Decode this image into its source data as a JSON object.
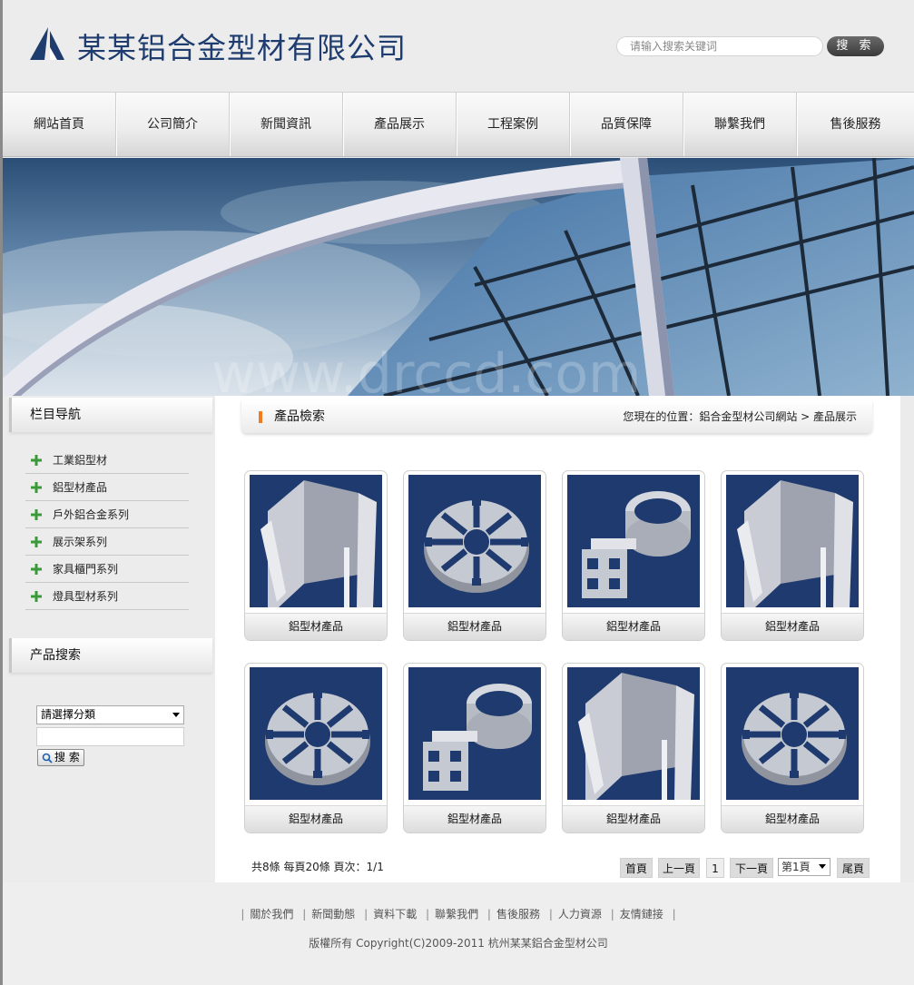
{
  "header": {
    "company_name": "某某铝合金型材有限公司",
    "search_placeholder": "请输入搜索关键词",
    "search_button": "搜 索"
  },
  "nav": {
    "items": [
      "網站首頁",
      "公司簡介",
      "新聞資訊",
      "產品展示",
      "工程案例",
      "品質保障",
      "聯繫我們",
      "售後服務"
    ]
  },
  "banner": {
    "watermark": "www.drccd.com"
  },
  "sidebar": {
    "nav_title": "栏目导航",
    "nav_items": [
      "工業鋁型材",
      "鋁型材產品",
      "戶外鋁合金系列",
      "展示架系列",
      "家具櫃門系列",
      "燈具型材系列"
    ],
    "search_title": "产品搜索",
    "category_select": "請選擇分類",
    "search_button": "搜 索"
  },
  "main": {
    "section_title": "產品檢索",
    "breadcrumb": "您現在的位置：鋁合金型材公司網站 > 產品展示",
    "products": [
      {
        "name": "鋁型材產品",
        "shape": "channel-icon"
      },
      {
        "name": "鋁型材產品",
        "shape": "round-profile-icon"
      },
      {
        "name": "鋁型材產品",
        "shape": "tube-profile-icon"
      },
      {
        "name": "鋁型材產品",
        "shape": "channel-icon"
      },
      {
        "name": "鋁型材產品",
        "shape": "round-profile-icon"
      },
      {
        "name": "鋁型材產品",
        "shape": "tube-profile-icon"
      },
      {
        "name": "鋁型材產品",
        "shape": "channel-icon"
      },
      {
        "name": "鋁型材產品",
        "shape": "round-profile-icon"
      }
    ],
    "pager": {
      "info": "共8條 每頁20條 頁次：1/1",
      "first": "首頁",
      "prev": "上一頁",
      "current": "1",
      "next": "下一頁",
      "page_select": "第1頁",
      "last": "尾頁"
    }
  },
  "footer": {
    "links": [
      "關於我們",
      "新聞動態",
      "資料下載",
      "聯繫我們",
      "售後服務",
      "人力資源",
      "友情鏈接"
    ],
    "copyright": "版權所有 Copyright(C)2009-2011 杭州某某鋁合金型材公司"
  },
  "colors": {
    "brand": "#1e3c6e",
    "accent": "#f07c1e",
    "product_bg": "#1f3a6e",
    "plus_green": "#3a9a3a"
  }
}
